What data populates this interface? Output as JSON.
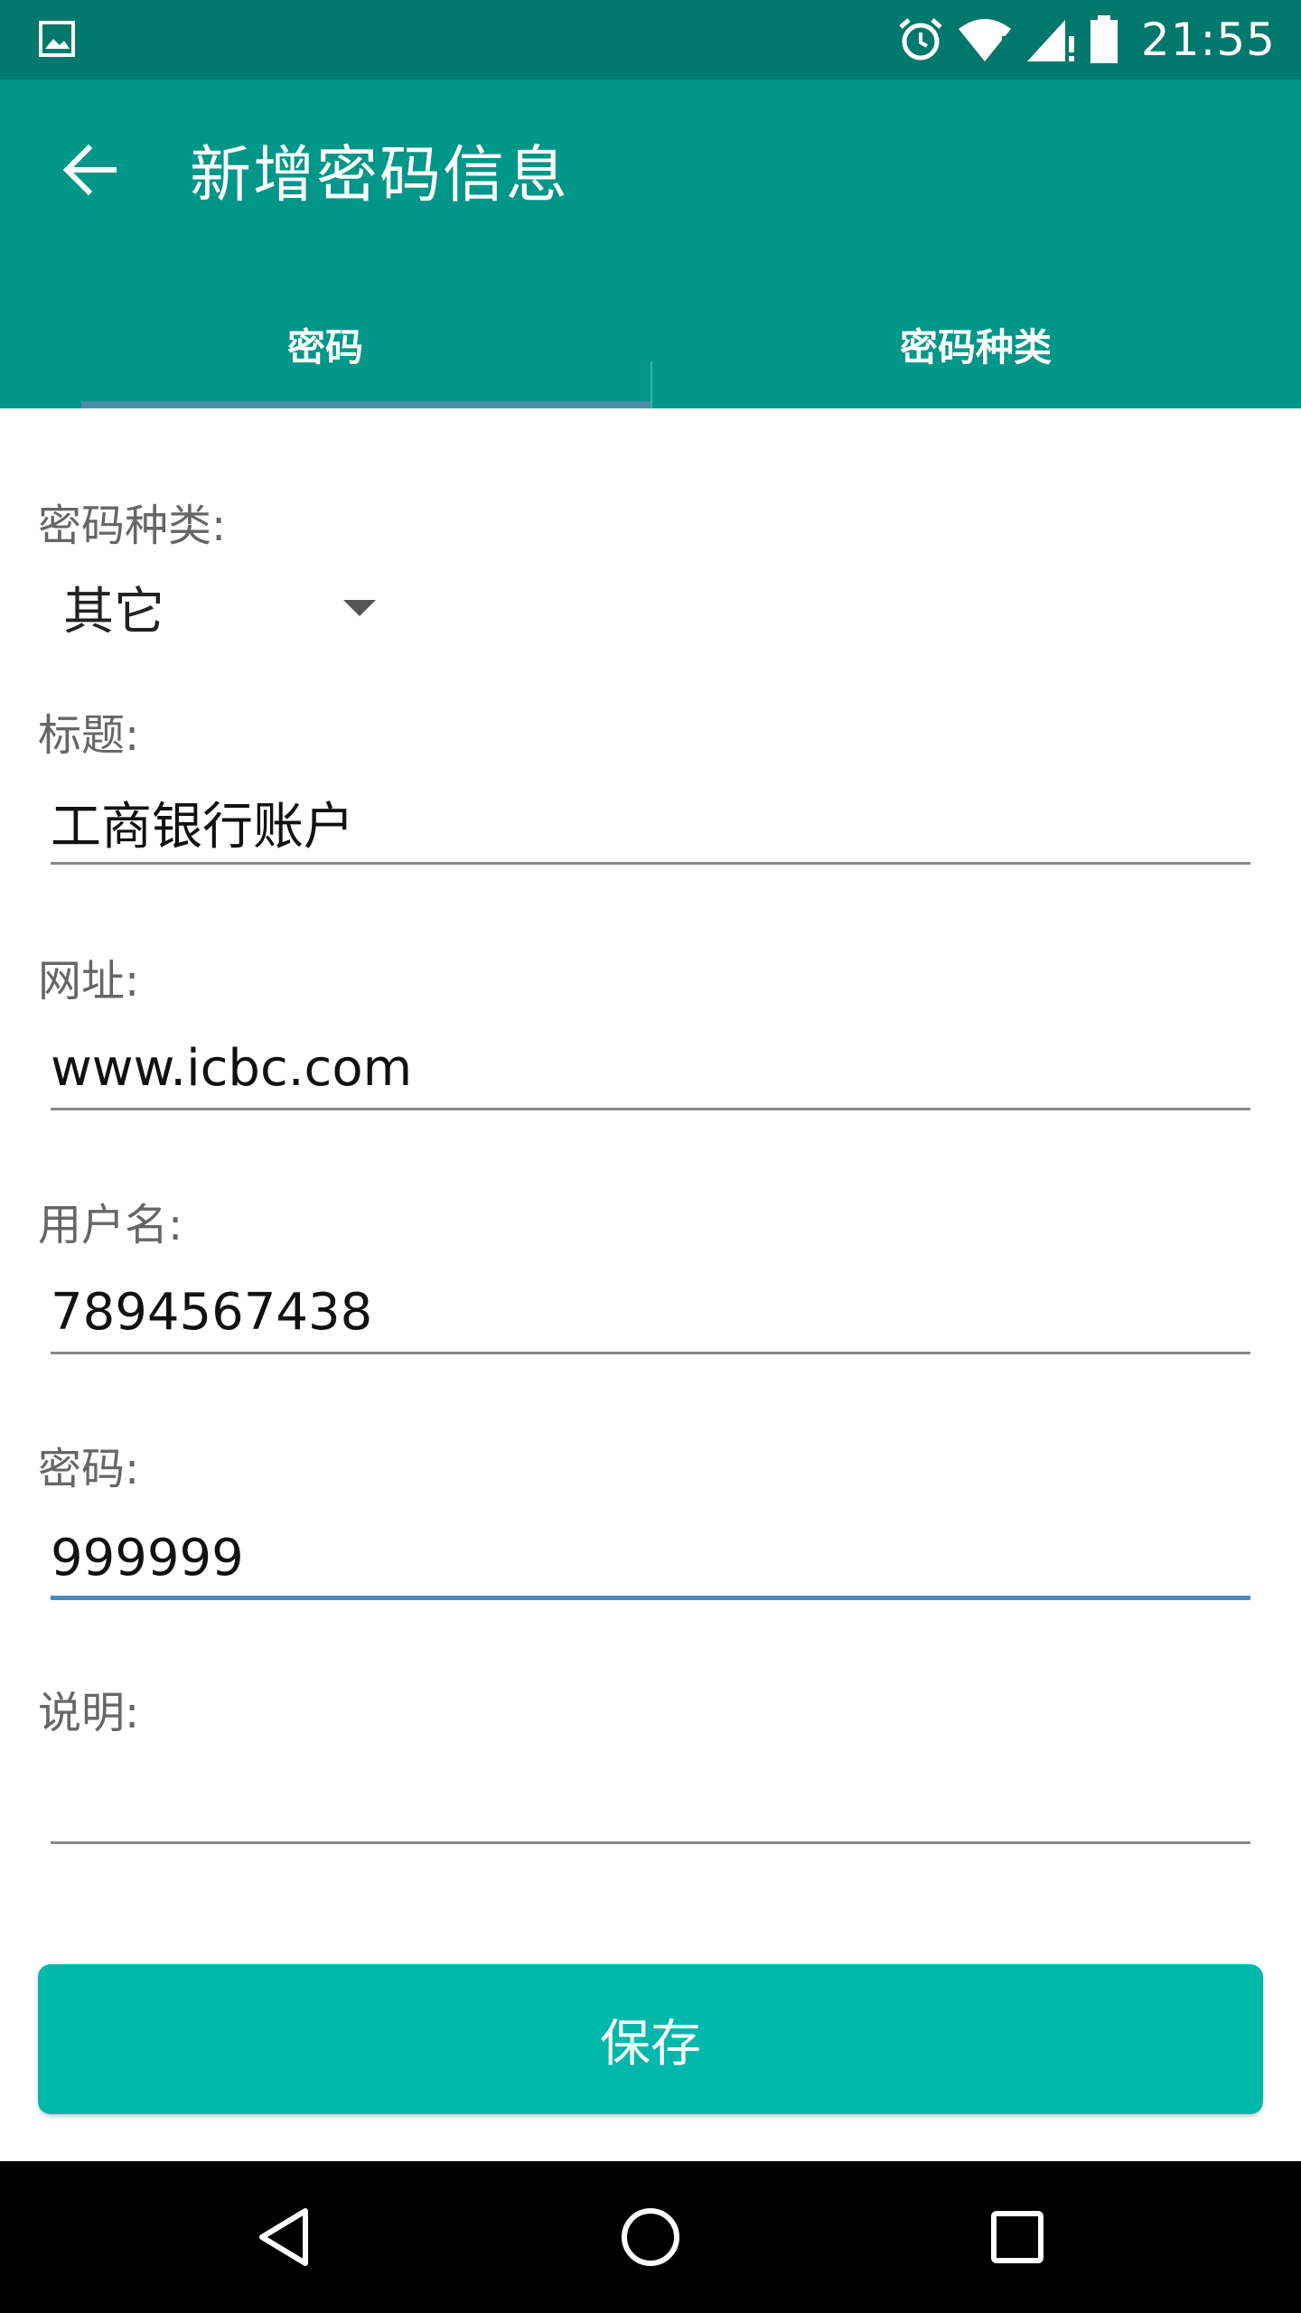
{
  "status_bar": {
    "time": "21:55",
    "icons": [
      "image-icon",
      "alarm-icon",
      "wifi-icon",
      "signal-icon",
      "battery-icon"
    ]
  },
  "app_bar": {
    "title": "新增密码信息",
    "back_icon": "arrow-back-icon",
    "tabs": [
      {
        "label": "密码",
        "selected": true
      },
      {
        "label": "密码种类",
        "selected": false
      }
    ]
  },
  "form": {
    "type_label": "密码种类:",
    "type_value": "其它",
    "title_label": "标题:",
    "title_value": "工商银行账户",
    "url_label": "网址:",
    "url_value": "www.icbc.com",
    "username_label": "用户名:",
    "username_value": "7894567438",
    "password_label": "密码:",
    "password_value": "999999",
    "note_label": "说明:",
    "note_value": ""
  },
  "save_button": {
    "label": "保存"
  },
  "colors": {
    "status_bar": "#00786b",
    "app_bar": "#009688",
    "save_button": "#00b8aa",
    "focus_underline": "#4a8bb8"
  },
  "nav_bar": {
    "icons": [
      "nav-back-icon",
      "nav-home-icon",
      "nav-recents-icon"
    ]
  }
}
